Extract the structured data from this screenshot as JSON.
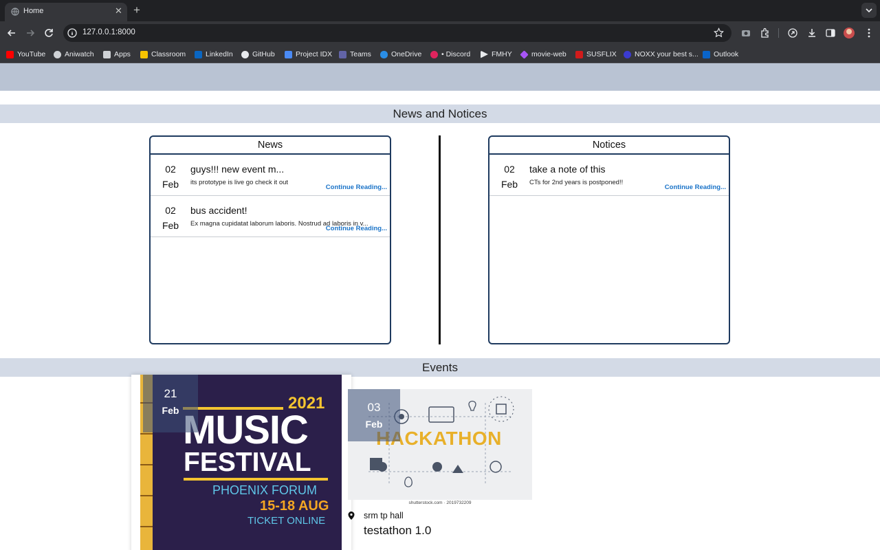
{
  "browser": {
    "tab_title": "Home",
    "url": "127.0.0.1:8000",
    "bookmarks": [
      {
        "label": "YouTube",
        "icon": "youtube-icon",
        "color": "#ff0000"
      },
      {
        "label": "Aniwatch",
        "icon": "aniwatch-icon",
        "color": "#e8eaed"
      },
      {
        "label": "Apps",
        "icon": "apps-icon",
        "color": "#e8eaed"
      },
      {
        "label": "Classroom",
        "icon": "classroom-icon",
        "color": "#f7c300"
      },
      {
        "label": "LinkedIn",
        "icon": "linkedin-icon",
        "color": "#0a66c2"
      },
      {
        "label": "GitHub",
        "icon": "github-icon",
        "color": "#e8eaed"
      },
      {
        "label": "Project IDX",
        "icon": "project-idx-icon",
        "color": "#4a8af4"
      },
      {
        "label": "Teams",
        "icon": "teams-icon",
        "color": "#6264a7"
      },
      {
        "label": "OneDrive",
        "icon": "onedrive-icon",
        "color": "#2a8ee6"
      },
      {
        "label": "• Discord",
        "icon": "discord-icon",
        "color": "#e0245e"
      },
      {
        "label": "FMHY",
        "icon": "fmhy-icon",
        "color": "#e8eaed"
      },
      {
        "label": "movie-web",
        "icon": "movie-web-icon",
        "color": "#a855f7"
      },
      {
        "label": "SUSFLIX",
        "icon": "susflix-icon",
        "color": "#d11b1b"
      },
      {
        "label": "NOXX your best s...",
        "icon": "noxx-icon",
        "color": "#3b3bd1"
      },
      {
        "label": "Outlook",
        "icon": "outlook-icon",
        "color": "#0a64c8"
      }
    ]
  },
  "main": {
    "news_notices_heading": "News and Notices",
    "news": {
      "heading": "News",
      "items": [
        {
          "day": "02",
          "month": "Feb",
          "title": "guys!!! new event m...",
          "body": "its prototype is live go check it out",
          "more": "Continue Reading..."
        },
        {
          "day": "02",
          "month": "Feb",
          "title": "bus accident!",
          "body": "Ex magna cupidatat laborum laboris. Nostrud ad laboris in v...",
          "more": "Continue Reading..."
        }
      ]
    },
    "notices": {
      "heading": "Notices",
      "items": [
        {
          "day": "02",
          "month": "Feb",
          "title": "take a note of this",
          "body": "CTs for 2nd years is postponed!!",
          "more": "Continue Reading..."
        }
      ]
    },
    "events_heading": "Events",
    "events": [
      {
        "day": "21",
        "month": "Feb",
        "poster": {
          "year": "2021",
          "line1": "MUSIC",
          "line2": "FESTIVAL",
          "venue": "PHOENIX FORUM",
          "dates": "15-18 AUG",
          "ticket": "TICKET ONLINE"
        }
      },
      {
        "day": "03",
        "month": "Feb",
        "image_title": "HACKATHON",
        "image_credit": "shutterstock.com · 2019732209",
        "location": "srm tp hall",
        "name": "testathon 1.0"
      }
    ]
  },
  "colors": {
    "header_bar": "#b9c3d3",
    "section_band": "#d3dae6",
    "panel_border": "#1e3a5f",
    "link": "#1a73c8"
  }
}
